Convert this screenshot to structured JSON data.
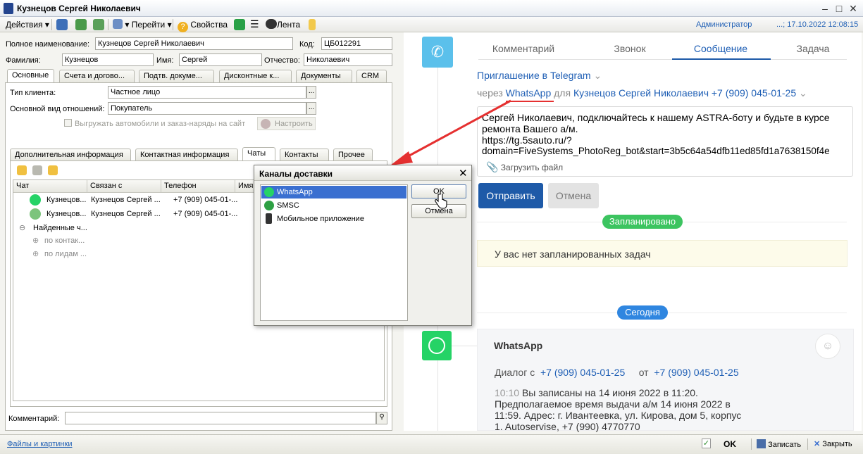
{
  "window": {
    "title": "Кузнецов Сергей Николаевич"
  },
  "toolbar": {
    "actions": "Действия",
    "goto": "Перейти",
    "properties": "Свойства",
    "feed": "Лента",
    "user": "Администратор",
    "datetime": "...; 17.10.2022 12:08:15"
  },
  "form": {
    "full_name_label": "Полное наименование:",
    "full_name_value": "Кузнецов Сергей Николаевич",
    "code_label": "Код:",
    "code_value": "ЦБ012291",
    "last_name_label": "Фамилия:",
    "last_name_value": "Кузнецов",
    "first_name_label": "Имя:",
    "first_name_value": "Сергей",
    "patronymic_label": "Отчество:",
    "patronymic_value": "Николаевич",
    "tabs": [
      "Основные",
      "Счета и догово...",
      "Подтв. докуме...",
      "Дисконтные к...",
      "Документы",
      "CRM"
    ],
    "client_type_label": "Тип клиента:",
    "client_type_value": "Частное лицо",
    "relation_label": "Основной вид отношений:",
    "relation_value": "Покупатель",
    "export_checkbox_label": "Выгружать автомобили и заказ-наряды на сайт",
    "setup_button": "Настроить",
    "subtabs": [
      "Дополнительная информация",
      "Контактная информация",
      "Чаты",
      "Контакты",
      "Прочее"
    ],
    "grid_headers": [
      "Чат",
      "Связан с",
      "Телефон",
      "Имя"
    ],
    "grid_rows": [
      {
        "chat": "Кузнецов...",
        "linked": "Кузнецов Сергей ...",
        "phone": "+7 (909) 045-01-..."
      },
      {
        "chat": "Кузнецов...",
        "linked": "Кузнецов Сергей ...",
        "phone": "+7 (909) 045-01-..."
      }
    ],
    "found_group": "Найденные ч...",
    "found_contacts": "по контак...",
    "found_leads": "по лидам ...",
    "comment_label": "Комментарий:"
  },
  "dialog": {
    "title": "Каналы доставки",
    "items": [
      "WhatsApp",
      "SMSC",
      "Мобильное приложение"
    ],
    "ok_label": "OK",
    "cancel_label": "Отмена"
  },
  "right": {
    "tabs": [
      "Комментарий",
      "Звонок",
      "Сообщение",
      "Задача"
    ],
    "template": "Приглашение в Telegram",
    "via_label": "через",
    "channel": "WhatsApp",
    "for_label": "для",
    "recipient": "Кузнецов Сергей Николаевич",
    "recipient_phone": "+7 (909) 045-01-25",
    "message_lines": [
      "Сергей Николаевич, подключайтесь к нашему ASTRA-боту и будьте в курсе",
      "ремонта Вашего а/м.",
      "https://tg.5sauto.ru/?",
      "domain=FiveSystems_PhotoReg_bot&start=3b5c64a54dfb11ed85fd1a7638150f4e"
    ],
    "attach_label": "Загрузить файл",
    "send_label": "Отправить",
    "cancel_label": "Отмена",
    "planned_pill": "Запланировано",
    "no_tasks": "У вас нет запланированных задач",
    "today_pill": "Сегодня",
    "card": {
      "title": "WhatsApp",
      "dialog_with_label": "Диалог с",
      "dialog_with": "+7 (909) 045-01-25",
      "from_label": "от",
      "from": "+7 (909) 045-01-25",
      "time": "10:10",
      "text_lines": [
        "Вы записаны на 14 июня 2022 в 11:20.",
        "Предполагаемое время выдачи а/м 14 июня 2022 в",
        "11:59. Адрес: г. Ивантеевка, ул. Кирова, дом 5, корпус",
        "1. Autoservise, +7 (990) 4770770"
      ]
    }
  },
  "bottom": {
    "files_link": "Файлы и картинки",
    "ok_label": "OK",
    "save_label": "Записать",
    "close_label": "Закрыть"
  },
  "colors": {
    "accent_blue": "#1e5aa8",
    "whatsapp_green": "#25d366",
    "pill_green": "#3cc460",
    "pill_blue": "#2f86e0",
    "arrow_red": "#e53030"
  }
}
